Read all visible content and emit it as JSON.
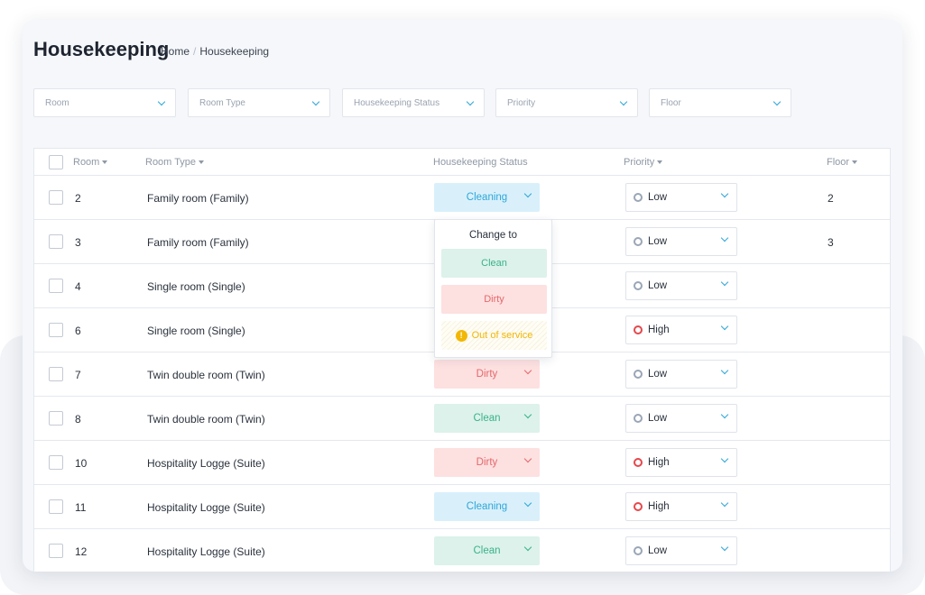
{
  "page": {
    "title": "Housekeeping",
    "breadcrumb": {
      "home": "Home",
      "separator": "/",
      "current": "Housekeeping"
    }
  },
  "filters": [
    {
      "placeholder": "Room"
    },
    {
      "placeholder": "Room Type"
    },
    {
      "placeholder": "Housekeeping Status"
    },
    {
      "placeholder": "Priority"
    },
    {
      "placeholder": "Floor"
    }
  ],
  "table": {
    "headers": {
      "room": "Room",
      "room_type": "Room Type",
      "status": "Housekeeping Status",
      "priority": "Priority",
      "floor": "Floor"
    },
    "rows": [
      {
        "room": "2",
        "room_type": "Family room (Family)",
        "status": "Cleaning",
        "status_key": "cleaning",
        "priority": "Low",
        "priority_key": "low",
        "floor": "2"
      },
      {
        "room": "3",
        "room_type": "Family room (Family)",
        "status": "",
        "status_key": "none",
        "priority": "Low",
        "priority_key": "low",
        "floor": "3"
      },
      {
        "room": "4",
        "room_type": "Single room (Single)",
        "status": "",
        "status_key": "none",
        "priority": "Low",
        "priority_key": "low",
        "floor": ""
      },
      {
        "room": "6",
        "room_type": "Single room (Single)",
        "status": "",
        "status_key": "none",
        "priority": "High",
        "priority_key": "high",
        "floor": ""
      },
      {
        "room": "7",
        "room_type": "Twin double room (Twin)",
        "status": "Dirty",
        "status_key": "dirty",
        "priority": "Low",
        "priority_key": "low",
        "floor": ""
      },
      {
        "room": "8",
        "room_type": "Twin double room (Twin)",
        "status": "Clean",
        "status_key": "clean",
        "priority": "Low",
        "priority_key": "low",
        "floor": ""
      },
      {
        "room": "10",
        "room_type": "Hospitality Logge (Suite)",
        "status": "Dirty",
        "status_key": "dirty",
        "priority": "High",
        "priority_key": "high",
        "floor": ""
      },
      {
        "room": "11",
        "room_type": "Hospitality Logge (Suite)",
        "status": "Cleaning",
        "status_key": "cleaning",
        "priority": "High",
        "priority_key": "high",
        "floor": ""
      },
      {
        "room": "12",
        "room_type": "Hospitality Logge (Suite)",
        "status": "Clean",
        "status_key": "clean",
        "priority": "Low",
        "priority_key": "low",
        "floor": ""
      }
    ]
  },
  "status_popup": {
    "title": "Change to",
    "options": {
      "clean": "Clean",
      "dirty": "Dirty",
      "out_of_service": "Out of service"
    },
    "warning_glyph": "!"
  },
  "colors": {
    "accent": "#2ea7d8",
    "clean": "#3bb28a",
    "dirty": "#e4686b",
    "warning": "#f2b705",
    "high_priority": "#e5484d"
  },
  "icons": {
    "dropdown": "chevron-down-icon",
    "sort": "caret-down-icon",
    "priority": "circle-dot-icon",
    "warning": "exclamation-circle-icon"
  }
}
